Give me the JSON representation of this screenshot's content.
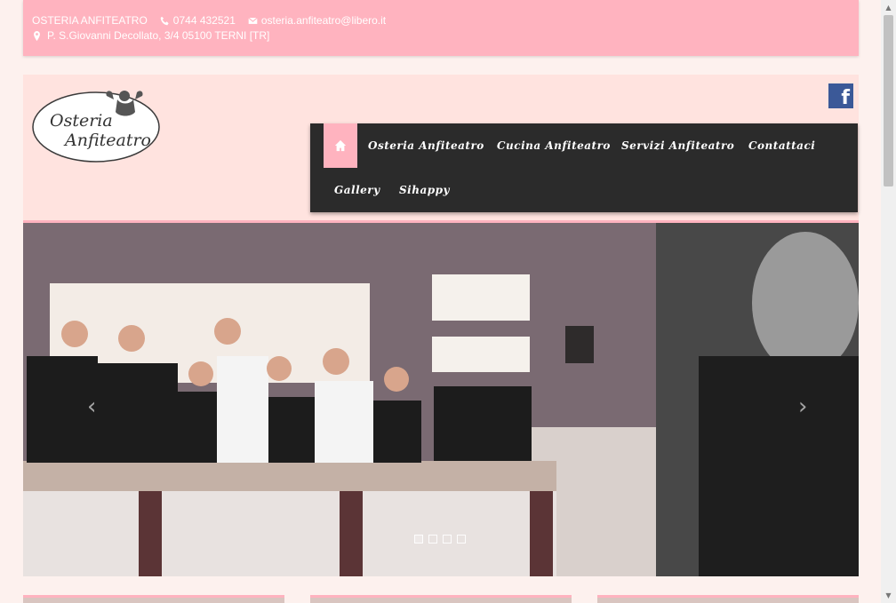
{
  "topbar": {
    "site_name": "OSTERIA ANFITEATRO",
    "phone": "0744 432521",
    "email": "osteria.anfiteatro@libero.it",
    "address": "P. S.Giovanni Decollato, 3/4 05100 TERNI [TR]"
  },
  "logo": {
    "line1": "Osteria",
    "line2": "Anfiteatro"
  },
  "social": {
    "facebook_glyph": "f"
  },
  "nav": {
    "items": [
      {
        "label": "Osteria Anfiteatro"
      },
      {
        "label": "Cucina Anfiteatro"
      },
      {
        "label": "Servizi Anfiteatro"
      },
      {
        "label": "Contattaci"
      },
      {
        "label": "Gallery"
      },
      {
        "label": "Sihappy"
      }
    ]
  },
  "slider": {
    "prev_glyph": "‹",
    "next_glyph": "›",
    "dots_count": 4,
    "active_dot": 1
  },
  "colors": {
    "accent": "#ffb3bf",
    "header_bg": "#ffe3df",
    "nav_bg": "#2b2b2b",
    "facebook": "#3b5998"
  }
}
